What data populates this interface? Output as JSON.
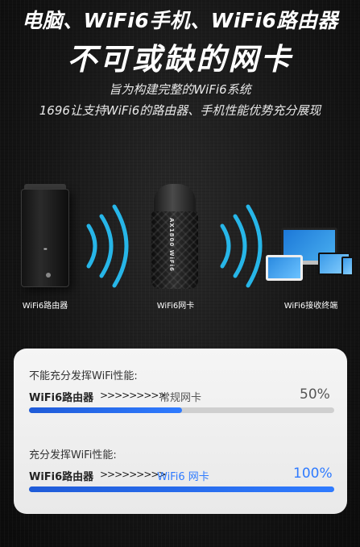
{
  "header": {
    "title_line1": "电脑、WiFi6手机、WiFi6路由器",
    "title_line2": "不可或缺的网卡",
    "subtitle_line1": "旨为构建完整的WiFi6系统",
    "subtitle_line2": "1696让支持WiFi6的路由器、手机性能优势充分展现"
  },
  "devices": {
    "router_label": "WiFi6路由器",
    "dongle_label": "WiFi6网卡",
    "dongle_print": "AX1800 WiFi6",
    "endpoints_label": "WiFi6接收终端"
  },
  "comparison": {
    "without": {
      "heading": "不能充分发挥WiFi性能:",
      "source": "WiFi6路由器",
      "arrows": ">>>>>>>>>",
      "target": "常规网卡",
      "percent_label": "50%",
      "percent": 0.5
    },
    "with": {
      "heading": "充分发挥WiFi性能:",
      "source": "WiFi6路由器",
      "arrows": ">>>>>>>>>",
      "target": "WiFi6 网卡",
      "percent_label": "100%",
      "percent": 1.0
    },
    "colors": {
      "accent": "#2f7bff",
      "muted_text": "#555555",
      "track": "#cfcfcf"
    }
  }
}
